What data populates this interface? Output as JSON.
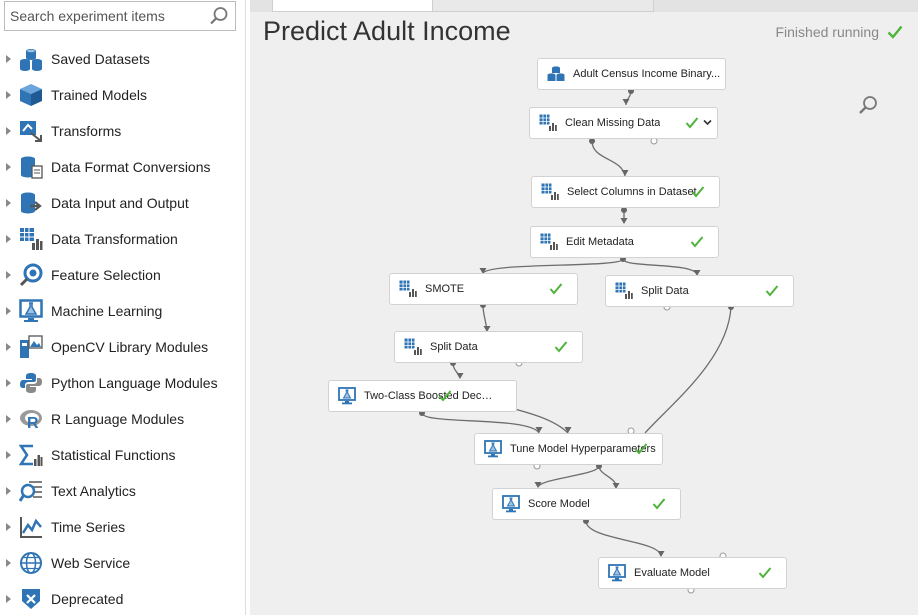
{
  "sidebar": {
    "search_placeholder": "Search experiment items",
    "items": [
      {
        "label": "Saved Datasets",
        "icon": "datasets-icon"
      },
      {
        "label": "Trained Models",
        "icon": "cube-icon"
      },
      {
        "label": "Transforms",
        "icon": "transform-icon"
      },
      {
        "label": "Data Format Conversions",
        "icon": "format-conversion-icon"
      },
      {
        "label": "Data Input and Output",
        "icon": "data-io-icon"
      },
      {
        "label": "Data Transformation",
        "icon": "data-transformation-icon"
      },
      {
        "label": "Feature Selection",
        "icon": "feature-selection-icon"
      },
      {
        "label": "Machine Learning",
        "icon": "flask-monitor-icon"
      },
      {
        "label": "OpenCV Library Modules",
        "icon": "opencv-icon"
      },
      {
        "label": "Python Language Modules",
        "icon": "python-icon"
      },
      {
        "label": "R Language Modules",
        "icon": "r-language-icon"
      },
      {
        "label": "Statistical Functions",
        "icon": "sigma-icon"
      },
      {
        "label": "Text Analytics",
        "icon": "text-analytics-icon"
      },
      {
        "label": "Time Series",
        "icon": "time-series-icon"
      },
      {
        "label": "Web Service",
        "icon": "globe-icon"
      },
      {
        "label": "Deprecated",
        "icon": "deprecated-icon"
      }
    ]
  },
  "canvas": {
    "title": "Predict Adult Income",
    "status": "Finished running"
  },
  "modules": [
    {
      "name": "Adult Census Income Binary...",
      "icon": "dataset-icon",
      "finished": false
    },
    {
      "name": "Clean Missing Data",
      "icon": "grid-chart-icon",
      "finished": true
    },
    {
      "name": "Select Columns in Dataset",
      "icon": "grid-chart-icon",
      "finished": true
    },
    {
      "name": "Edit Metadata",
      "icon": "grid-chart-icon",
      "finished": true
    },
    {
      "name": "SMOTE",
      "icon": "grid-chart-icon",
      "finished": true
    },
    {
      "name": "Split Data",
      "icon": "grid-chart-icon",
      "finished": true
    },
    {
      "name": "Split Data",
      "icon": "grid-chart-icon",
      "finished": true
    },
    {
      "name": "Two-Class Boosted Decision...",
      "icon": "flask-monitor-icon",
      "finished": true
    },
    {
      "name": "Tune Model Hyperparameters",
      "icon": "flask-monitor-icon",
      "finished": true
    },
    {
      "name": "Score Model",
      "icon": "flask-monitor-icon",
      "finished": true
    },
    {
      "name": "Evaluate Model",
      "icon": "flask-monitor-icon",
      "finished": true
    }
  ],
  "colors": {
    "accent": "#2f74b5",
    "check": "#4fb33a",
    "canvas_bg": "#efefef",
    "wire": "#666666"
  }
}
